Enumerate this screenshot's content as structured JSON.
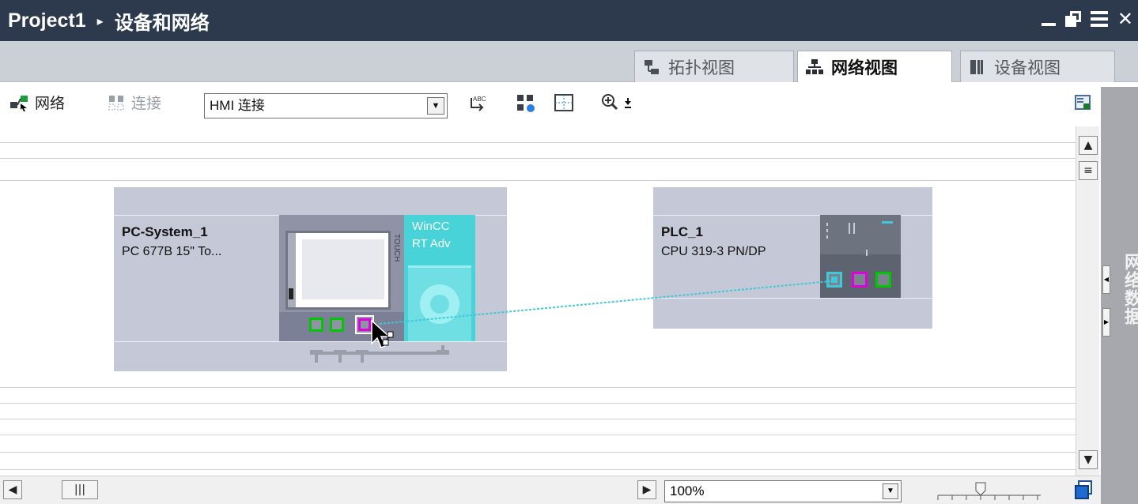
{
  "window": {
    "project": "Project1",
    "breadcrumb_sep": "▸",
    "title": "设备和网络"
  },
  "tabs": [
    {
      "label": "拓扑视图",
      "icon": "topology-view-icon",
      "active": false
    },
    {
      "label": "网络视图",
      "icon": "network-view-icon",
      "active": true
    },
    {
      "label": "设备视图",
      "icon": "device-view-icon",
      "active": false
    }
  ],
  "toolbar": {
    "network_label": "网络",
    "connection_label": "连接",
    "connection_type_value": "HMI 连接"
  },
  "devices": [
    {
      "name": "PC-System_1",
      "type": "PC 677B 15\" To...",
      "runtime_line1": "WinCC",
      "runtime_line2": "RT Adv",
      "panel_text": "TOUCH"
    },
    {
      "name": "PLC_1",
      "type": "CPU 319-3 PN/DP"
    }
  ],
  "side_panel": {
    "label": "网络数据"
  },
  "statusbar": {
    "zoom_value": "100%"
  },
  "colors": {
    "titlebar": "#2d3a4e",
    "device_box": "#c5c8d6",
    "wincc_teal": "#48d3d8",
    "port_green": "#00c800",
    "port_magenta": "#e000e0",
    "connection_line": "#3ec8d8"
  }
}
